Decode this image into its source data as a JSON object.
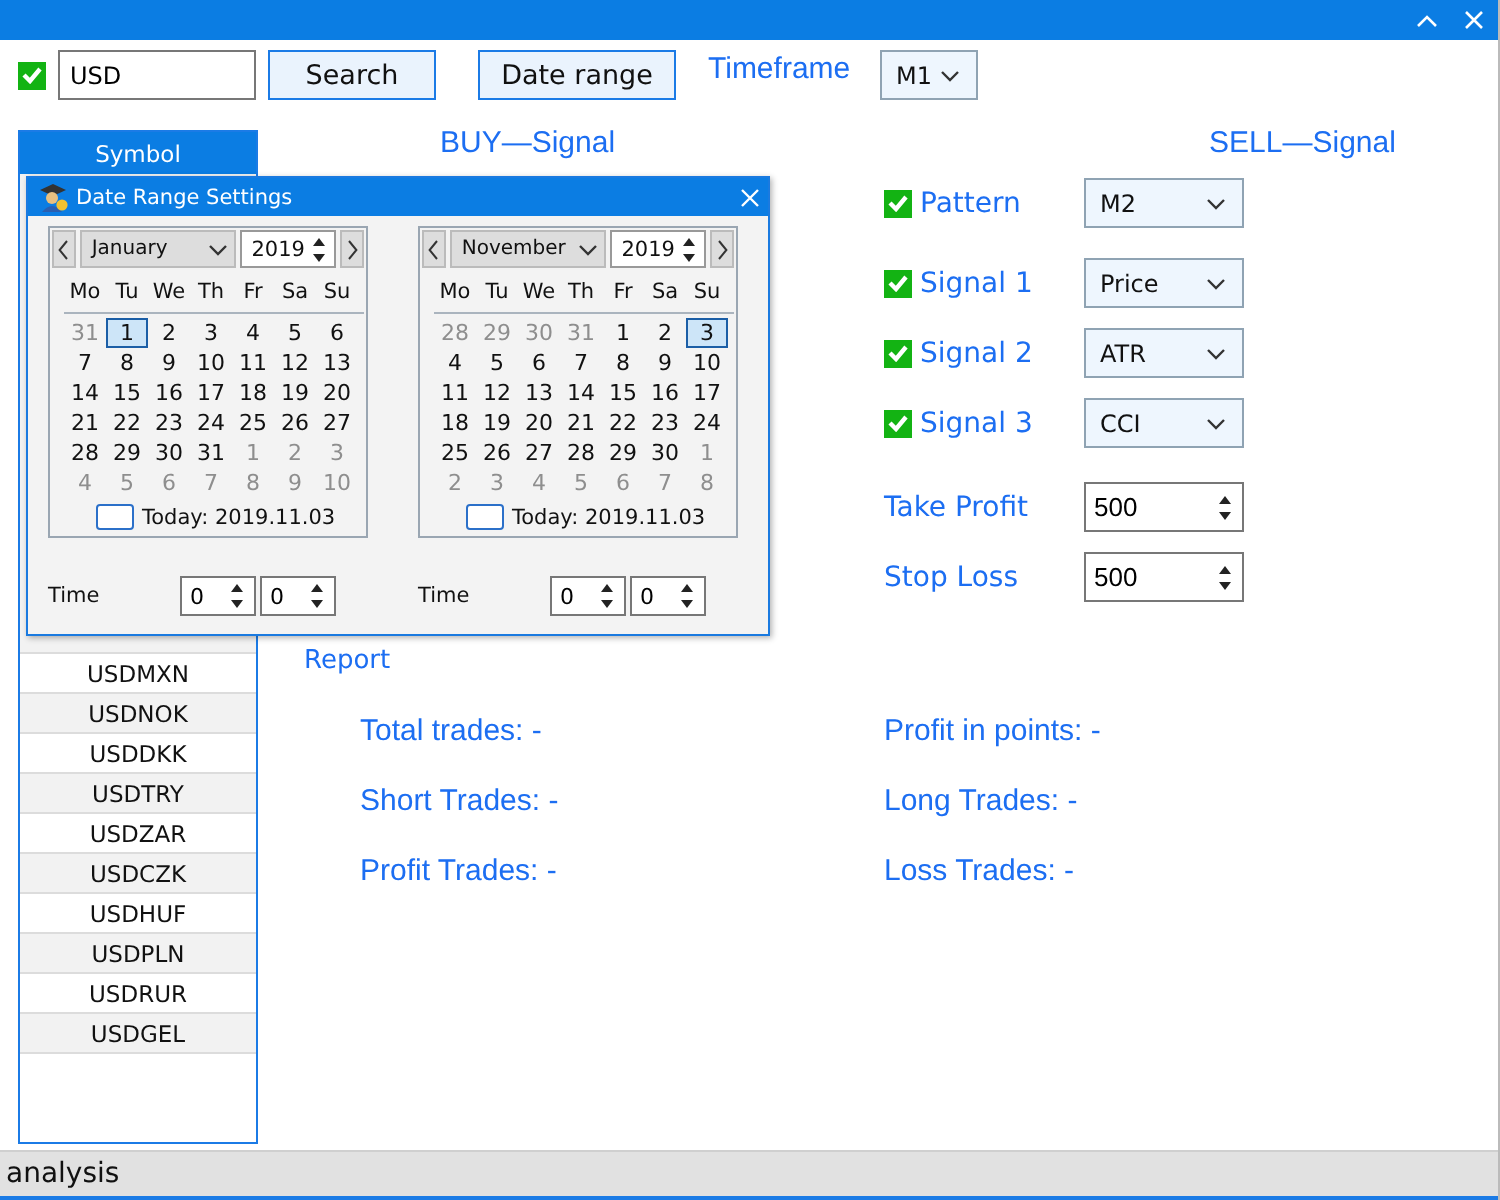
{
  "toolbar": {
    "filter_enabled": true,
    "symbol_filter": "USD",
    "search_button": "Search",
    "date_range_button": "Date range",
    "timeframe_label": "Timeframe",
    "timeframe": "M1"
  },
  "symbol_list": {
    "header": "Symbol",
    "rows": [
      "USDMXN",
      "USDNOK",
      "USDDKK",
      "USDTRY",
      "USDZAR",
      "USDCZK",
      "USDHUF",
      "USDPLN",
      "USDRUR",
      "USDGEL"
    ]
  },
  "buy_signal": {
    "title": "BUY—Signal"
  },
  "sell_signal": {
    "title": "SELL—Signal",
    "filters": [
      {
        "label": "Pattern",
        "checked": true,
        "value": "M2"
      },
      {
        "label": "Signal 1",
        "checked": true,
        "value": "Price"
      },
      {
        "label": "Signal 2",
        "checked": true,
        "value": "ATR"
      },
      {
        "label": "Signal 3",
        "checked": true,
        "value": "CCI"
      }
    ],
    "take_profit": {
      "label": "Take Profit",
      "value": "500"
    },
    "stop_loss": {
      "label": "Stop Loss",
      "value": "500"
    }
  },
  "report": {
    "title": "Report",
    "stats": [
      "Total trades: -",
      "Profit in points: -",
      "Short Trades: -",
      "Long Trades: -",
      "Profit Trades: -",
      "Loss Trades: -"
    ]
  },
  "status_bar": {
    "text": "analysis"
  },
  "dialog": {
    "title": "Date Range Settings",
    "calendars": [
      {
        "month": "January",
        "year": "2019",
        "weekdays": [
          "Mo",
          "Tu",
          "We",
          "Th",
          "Fr",
          "Sa",
          "Su"
        ],
        "days": [
          {
            "day": "31",
            "dim": true,
            "selected": false
          },
          {
            "day": "1",
            "dim": false,
            "selected": true
          },
          {
            "day": "2",
            "dim": false,
            "selected": false
          },
          {
            "day": "3",
            "dim": false,
            "selected": false
          },
          {
            "day": "4",
            "dim": false,
            "selected": false
          },
          {
            "day": "5",
            "dim": false,
            "selected": false
          },
          {
            "day": "6",
            "dim": false,
            "selected": false
          },
          {
            "day": "7",
            "dim": false,
            "selected": false
          },
          {
            "day": "8",
            "dim": false,
            "selected": false
          },
          {
            "day": "9",
            "dim": false,
            "selected": false
          },
          {
            "day": "10",
            "dim": false,
            "selected": false
          },
          {
            "day": "11",
            "dim": false,
            "selected": false
          },
          {
            "day": "12",
            "dim": false,
            "selected": false
          },
          {
            "day": "13",
            "dim": false,
            "selected": false
          },
          {
            "day": "14",
            "dim": false,
            "selected": false
          },
          {
            "day": "15",
            "dim": false,
            "selected": false
          },
          {
            "day": "16",
            "dim": false,
            "selected": false
          },
          {
            "day": "17",
            "dim": false,
            "selected": false
          },
          {
            "day": "18",
            "dim": false,
            "selected": false
          },
          {
            "day": "19",
            "dim": false,
            "selected": false
          },
          {
            "day": "20",
            "dim": false,
            "selected": false
          },
          {
            "day": "21",
            "dim": false,
            "selected": false
          },
          {
            "day": "22",
            "dim": false,
            "selected": false
          },
          {
            "day": "23",
            "dim": false,
            "selected": false
          },
          {
            "day": "24",
            "dim": false,
            "selected": false
          },
          {
            "day": "25",
            "dim": false,
            "selected": false
          },
          {
            "day": "26",
            "dim": false,
            "selected": false
          },
          {
            "day": "27",
            "dim": false,
            "selected": false
          },
          {
            "day": "28",
            "dim": false,
            "selected": false
          },
          {
            "day": "29",
            "dim": false,
            "selected": false
          },
          {
            "day": "30",
            "dim": false,
            "selected": false
          },
          {
            "day": "31",
            "dim": false,
            "selected": false
          },
          {
            "day": "1",
            "dim": true,
            "selected": false
          },
          {
            "day": "2",
            "dim": true,
            "selected": false
          },
          {
            "day": "3",
            "dim": true,
            "selected": false
          },
          {
            "day": "4",
            "dim": true,
            "selected": false
          },
          {
            "day": "5",
            "dim": true,
            "selected": false
          },
          {
            "day": "6",
            "dim": true,
            "selected": false
          },
          {
            "day": "7",
            "dim": true,
            "selected": false
          },
          {
            "day": "8",
            "dim": true,
            "selected": false
          },
          {
            "day": "9",
            "dim": true,
            "selected": false
          },
          {
            "day": "10",
            "dim": true,
            "selected": false
          }
        ],
        "today": "Today: 2019.11.03",
        "time_label": "Time",
        "hour": "0",
        "minute": "0"
      },
      {
        "month": "November",
        "year": "2019",
        "weekdays": [
          "Mo",
          "Tu",
          "We",
          "Th",
          "Fr",
          "Sa",
          "Su"
        ],
        "days": [
          {
            "day": "28",
            "dim": true,
            "selected": false
          },
          {
            "day": "29",
            "dim": true,
            "selected": false
          },
          {
            "day": "30",
            "dim": true,
            "selected": false
          },
          {
            "day": "31",
            "dim": true,
            "selected": false
          },
          {
            "day": "1",
            "dim": false,
            "selected": false
          },
          {
            "day": "2",
            "dim": false,
            "selected": false
          },
          {
            "day": "3",
            "dim": false,
            "selected": true
          },
          {
            "day": "4",
            "dim": false,
            "selected": false
          },
          {
            "day": "5",
            "dim": false,
            "selected": false
          },
          {
            "day": "6",
            "dim": false,
            "selected": false
          },
          {
            "day": "7",
            "dim": false,
            "selected": false
          },
          {
            "day": "8",
            "dim": false,
            "selected": false
          },
          {
            "day": "9",
            "dim": false,
            "selected": false
          },
          {
            "day": "10",
            "dim": false,
            "selected": false
          },
          {
            "day": "11",
            "dim": false,
            "selected": false
          },
          {
            "day": "12",
            "dim": false,
            "selected": false
          },
          {
            "day": "13",
            "dim": false,
            "selected": false
          },
          {
            "day": "14",
            "dim": false,
            "selected": false
          },
          {
            "day": "15",
            "dim": false,
            "selected": false
          },
          {
            "day": "16",
            "dim": false,
            "selected": false
          },
          {
            "day": "17",
            "dim": false,
            "selected": false
          },
          {
            "day": "18",
            "dim": false,
            "selected": false
          },
          {
            "day": "19",
            "dim": false,
            "selected": false
          },
          {
            "day": "20",
            "dim": false,
            "selected": false
          },
          {
            "day": "21",
            "dim": false,
            "selected": false
          },
          {
            "day": "22",
            "dim": false,
            "selected": false
          },
          {
            "day": "23",
            "dim": false,
            "selected": false
          },
          {
            "day": "24",
            "dim": false,
            "selected": false
          },
          {
            "day": "25",
            "dim": false,
            "selected": false
          },
          {
            "day": "26",
            "dim": false,
            "selected": false
          },
          {
            "day": "27",
            "dim": false,
            "selected": false
          },
          {
            "day": "28",
            "dim": false,
            "selected": false
          },
          {
            "day": "29",
            "dim": false,
            "selected": false
          },
          {
            "day": "30",
            "dim": false,
            "selected": false
          },
          {
            "day": "1",
            "dim": true,
            "selected": false
          },
          {
            "day": "2",
            "dim": true,
            "selected": false
          },
          {
            "day": "3",
            "dim": true,
            "selected": false
          },
          {
            "day": "4",
            "dim": true,
            "selected": false
          },
          {
            "day": "5",
            "dim": true,
            "selected": false
          },
          {
            "day": "6",
            "dim": true,
            "selected": false
          },
          {
            "day": "7",
            "dim": true,
            "selected": false
          },
          {
            "day": "8",
            "dim": true,
            "selected": false
          }
        ],
        "today": "Today: 2019.11.03",
        "time_label": "Time",
        "hour": "0",
        "minute": "0"
      }
    ]
  }
}
